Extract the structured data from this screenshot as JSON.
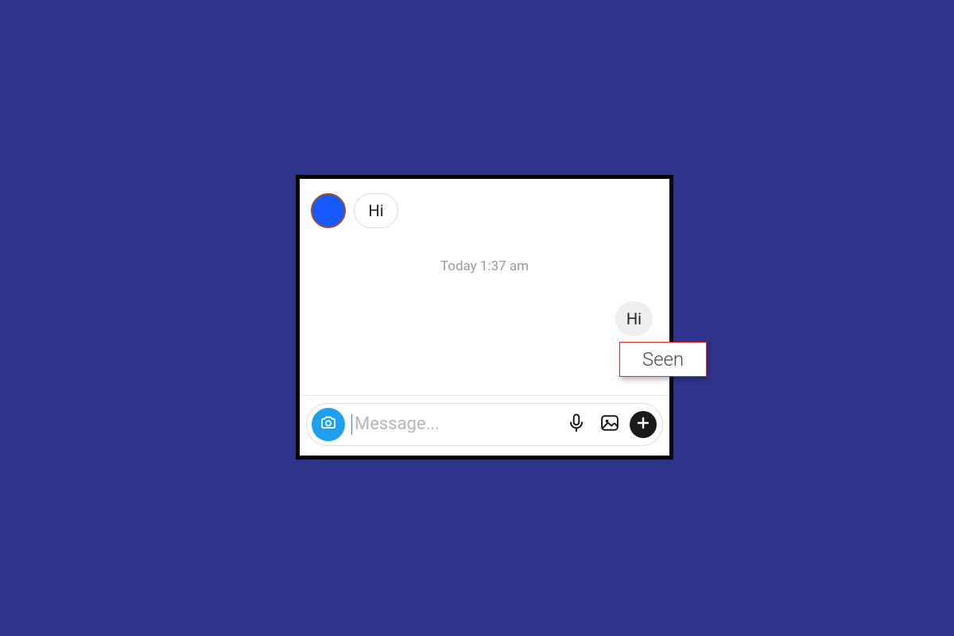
{
  "chat": {
    "incoming": {
      "text": "Hi"
    },
    "timestamp": "Today 1:37 am",
    "outgoing": {
      "text": "Hi"
    },
    "status_label": "Seen"
  },
  "composer": {
    "placeholder": "Message..."
  }
}
